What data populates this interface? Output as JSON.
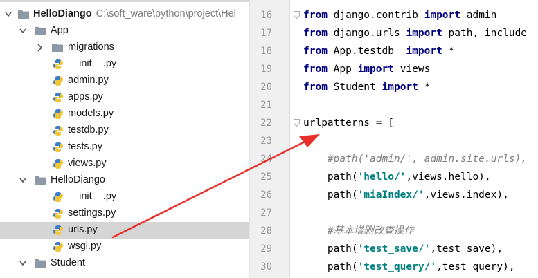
{
  "project_tree": {
    "root_name": "HelloDiango",
    "root_path": "C:\\soft_ware\\python\\project\\Hel",
    "app_folder": "App",
    "migrations": "migrations",
    "app_files": [
      "__init__.py",
      "admin.py",
      "apps.py",
      "models.py",
      "testdb.py",
      "tests.py",
      "views.py"
    ],
    "hello_folder": "HelloDiango",
    "hello_files": [
      "__init__.py",
      "settings.py",
      "urls.py",
      "wsgi.py"
    ],
    "student_folder": "Student",
    "selected_file": "urls.py"
  },
  "editor": {
    "line_numbers": [
      "16",
      "17",
      "18",
      "19",
      "20",
      "21",
      "22",
      "23",
      "24",
      "25",
      "26",
      "27",
      "28",
      "29",
      "30"
    ],
    "lines": {
      "l16": {
        "kw1": "from",
        "t1": " django.contrib ",
        "kw2": "import",
        "t2": " admin"
      },
      "l17": {
        "kw1": "from",
        "t1": " django.urls ",
        "kw2": "import",
        "t2": " path, include"
      },
      "l18": {
        "kw1": "from",
        "t1": " App.testdb  ",
        "kw2": "import",
        "t2": " *"
      },
      "l19": {
        "kw1": "from",
        "t1": " App ",
        "kw2": "import",
        "t2": " views"
      },
      "l20": {
        "kw1": "from",
        "t1": " Student ",
        "kw2": "import",
        "t2": " *"
      },
      "l22": {
        "t1": "urlpatterns = ["
      },
      "l24": {
        "indent": "    ",
        "c": "#path('admin/', admin.site.urls),"
      },
      "l25": {
        "indent": "    ",
        "t1": "path(",
        "s1": "'hello/'",
        "t2": ",views.hello),"
      },
      "l26": {
        "indent": "    ",
        "t1": "path(",
        "s1": "'miaIndex/'",
        "t2": ",views.index),"
      },
      "l28": {
        "indent": "    ",
        "c": "#基本增删改查操作"
      },
      "l29": {
        "indent": "    ",
        "t1": "path(",
        "s1": "'test_save/'",
        "t2": ",test_save),"
      },
      "l30": {
        "indent": "    ",
        "t1": "path(",
        "s1": "'test_query/'",
        "t2": ",test_query),"
      }
    }
  },
  "colors": {
    "keyword": "#000080",
    "string": "#008080",
    "comment": "#808080",
    "annotation_arrow": "#e8302a",
    "selection": "#d5d5d5"
  }
}
